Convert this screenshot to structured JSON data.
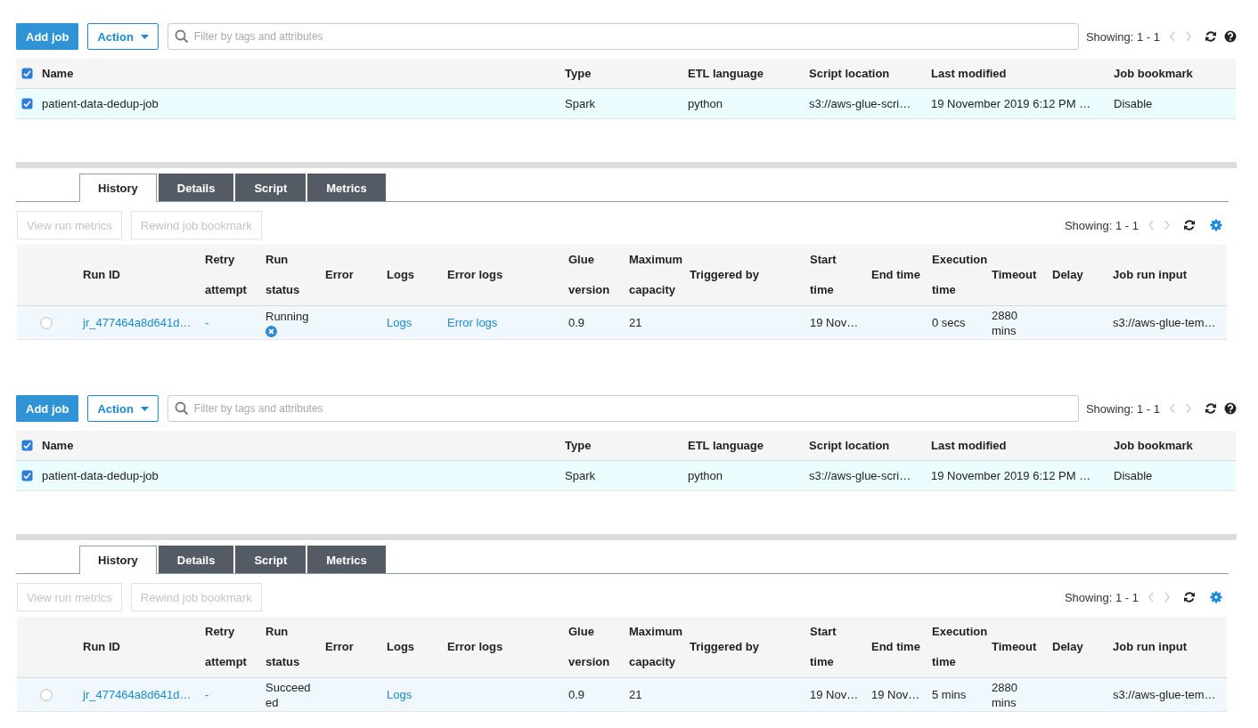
{
  "panels": [
    {
      "toolbar": {
        "add_button": "Add job",
        "action_button": "Action",
        "search": {
          "placeholder": "Filter by tags and attributes"
        },
        "showing": "Showing: 1 - 1"
      },
      "jobs_table": {
        "all_checked": true,
        "columns": [
          "Name",
          "Type",
          "ETL language",
          "Script location",
          "Last modified",
          "Job bookmark"
        ],
        "rows": [
          {
            "checked": true,
            "cells": [
              "patient-data-dedup-job",
              "Spark",
              "python",
              "s3://aws-glue-scri…",
              "19 November 2019 6:12 PM …",
              "Disable"
            ]
          }
        ]
      },
      "tabs": [
        {
          "label": "History",
          "selected": true
        },
        {
          "label": "Details",
          "selected": false
        },
        {
          "label": "Script",
          "selected": false
        },
        {
          "label": "Metrics",
          "selected": false
        }
      ],
      "history": {
        "buttons": [
          {
            "label": "View run metrics",
            "disabled": true
          },
          {
            "label": "Rewind job bookmark",
            "disabled": true
          }
        ],
        "showing": "Showing: 1 - 1",
        "columns": [
          "Run ID",
          "Retry\nattempt",
          "Run\nstatus",
          "Error",
          "Logs",
          "Error logs",
          "Glue\nversion",
          "Maximum\ncapacity",
          "Triggered by",
          "Start\ntime",
          "End time",
          "Execution\ntime",
          "Timeout",
          "Delay",
          "Job run input"
        ],
        "rows": [
          {
            "selected": false,
            "run_id": "jr_477464a8d641d…",
            "retry_attempt": "-",
            "run_status": "Running",
            "stop_control": true,
            "logs": "Logs",
            "error_logs": "Error logs",
            "glue_version": "0.9",
            "maximum_capacity": "21",
            "start_time": "19 Nov…",
            "execution_time": "0 secs",
            "timeout": "2880 mins",
            "job_run_input": "s3://aws-glue-tem…"
          }
        ]
      }
    },
    {
      "toolbar": {
        "add_button": "Add job",
        "action_button": "Action",
        "search": {
          "placeholder": "Filter by tags and attributes"
        },
        "showing": "Showing: 1 - 1"
      },
      "jobs_table": {
        "all_checked": true,
        "columns": [
          "Name",
          "Type",
          "ETL language",
          "Script location",
          "Last modified",
          "Job bookmark"
        ],
        "rows": [
          {
            "checked": true,
            "cells": [
              "patient-data-dedup-job",
              "Spark",
              "python",
              "s3://aws-glue-scri…",
              "19 November 2019 6:12 PM …",
              "Disable"
            ]
          }
        ]
      },
      "tabs": [
        {
          "label": "History",
          "selected": true
        },
        {
          "label": "Details",
          "selected": false
        },
        {
          "label": "Script",
          "selected": false
        },
        {
          "label": "Metrics",
          "selected": false
        }
      ],
      "history": {
        "buttons": [
          {
            "label": "View run metrics",
            "disabled": true
          },
          {
            "label": "Rewind job bookmark",
            "disabled": true
          }
        ],
        "showing": "Showing: 1 - 1",
        "columns": [
          "Run ID",
          "Retry\nattempt",
          "Run\nstatus",
          "Error",
          "Logs",
          "Error logs",
          "Glue\nversion",
          "Maximum\ncapacity",
          "Triggered by",
          "Start\ntime",
          "End time",
          "Execution\ntime",
          "Timeout",
          "Delay",
          "Job run input"
        ],
        "rows": [
          {
            "selected": false,
            "run_id": "jr_477464a8d641d…",
            "retry_attempt": "-",
            "run_status": "Succeeded",
            "stop_control": false,
            "logs": "Logs",
            "glue_version": "0.9",
            "maximum_capacity": "21",
            "start_time": "19 Nov…",
            "end_time": "19 Nov…",
            "execution_time": "5 mins",
            "timeout": "2880 mins",
            "job_run_input": "s3://aws-glue-tem…"
          }
        ]
      }
    }
  ]
}
